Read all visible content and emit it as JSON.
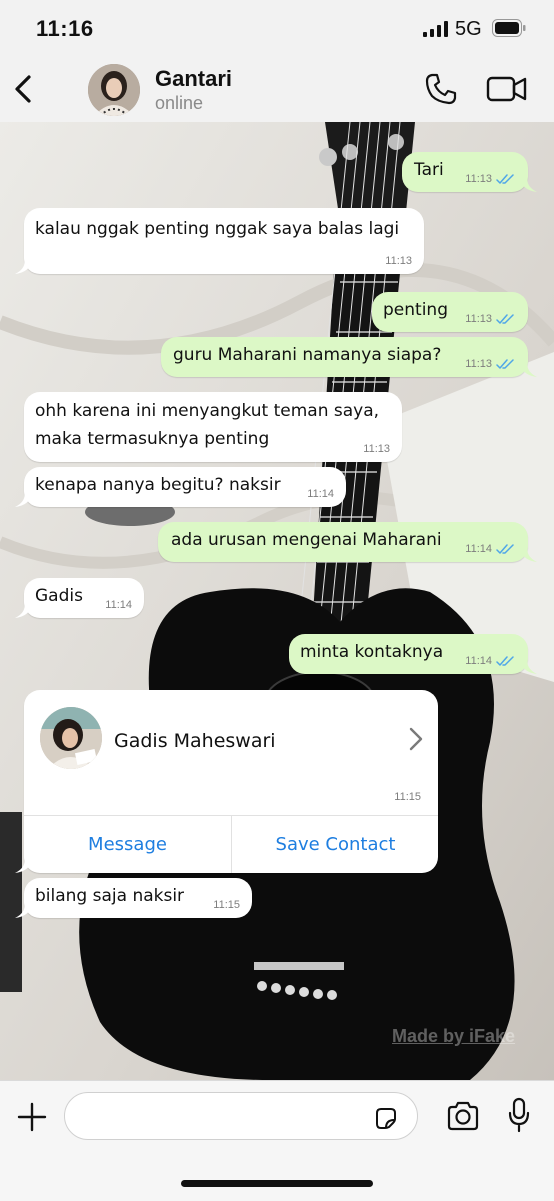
{
  "status_bar": {
    "time": "11:16",
    "network": "5G"
  },
  "header": {
    "contact_name": "Gantari",
    "contact_status": "online"
  },
  "messages": [
    {
      "dir": "out",
      "text": "Tari",
      "time": "11:13",
      "read": true
    },
    {
      "dir": "in",
      "text": "kalau nggak penting nggak saya balas lagi",
      "time": "11:13"
    },
    {
      "dir": "out",
      "text": "penting",
      "time": "11:13",
      "read": true
    },
    {
      "dir": "out",
      "text": "guru Maharani namanya siapa?",
      "time": "11:13",
      "read": true
    },
    {
      "dir": "in",
      "text": "ohh karena ini menyangkut teman saya,",
      "text2": "maka termasuknya penting",
      "time": "11:13"
    },
    {
      "dir": "in",
      "text": "kenapa nanya begitu? naksir",
      "time": "11:14"
    },
    {
      "dir": "out",
      "text": "ada urusan mengenai Maharani",
      "time": "11:14",
      "read": true
    },
    {
      "dir": "in",
      "text": "Gadis",
      "time": "11:14"
    },
    {
      "dir": "out",
      "text": "minta kontaknya",
      "time": "11:14",
      "read": true
    },
    {
      "dir": "in",
      "text": "bilang saja naksir",
      "time": "11:15"
    }
  ],
  "contact_card": {
    "name": "Gadis Maheswari",
    "time": "11:15",
    "message_button": "Message",
    "save_button": "Save Contact"
  },
  "watermark": "Made by iFake",
  "colors": {
    "outgoing_bubble": "#dcf8c6",
    "incoming_bubble": "#ffffff",
    "link_blue": "#1e7ee0",
    "read_ticks": "#4fa6e8"
  }
}
